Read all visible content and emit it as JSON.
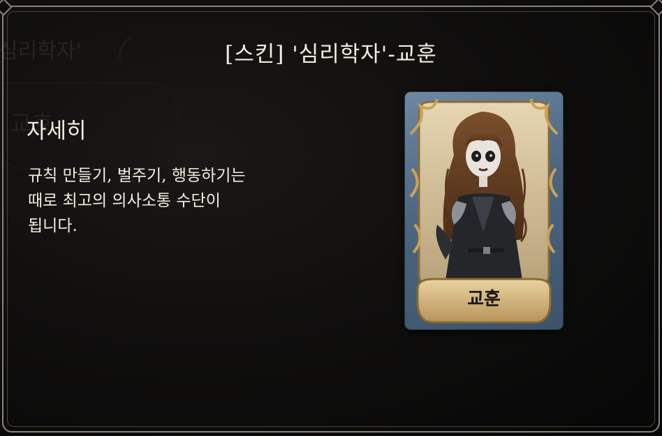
{
  "dialog": {
    "title": "[스킨] '심리학자'-교훈",
    "section_heading": "자세히",
    "description": "규칙 만들기, 벌주기, 행동하기는\n때로 최고의 의사소통 수단이\n됩니다."
  },
  "background": {
    "ghost_title": "심리학자'",
    "ghost_text": "교호"
  },
  "card": {
    "name": "교훈",
    "icon": "character-portrait"
  },
  "colors": {
    "text": "#f3eee2",
    "frame": "#8a8478",
    "card_blue": "#5b7694",
    "card_gold": "#c9a25a"
  }
}
